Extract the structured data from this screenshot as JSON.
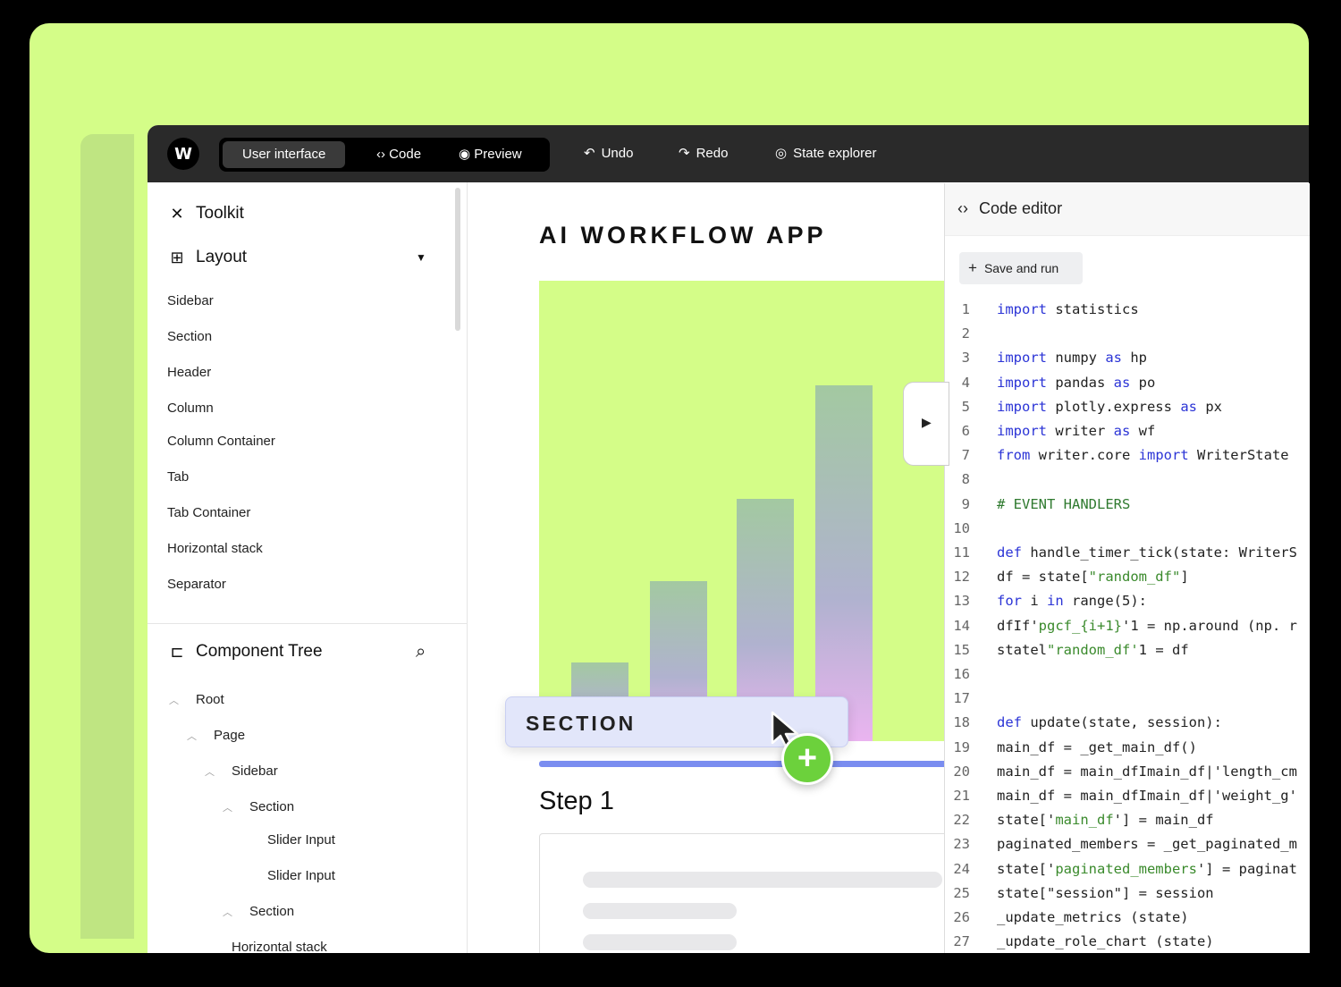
{
  "topbar": {
    "logo": "W",
    "modes": [
      {
        "label": "User interface",
        "active": true
      },
      {
        "label": "Code",
        "icon": "<>"
      },
      {
        "label": "Preview",
        "icon": "eye-icon"
      }
    ],
    "undo": "Undo",
    "redo": "Redo",
    "state_explorer": "State explorer"
  },
  "sidebar": {
    "toolkit": "Toolkit",
    "layout": "Layout",
    "layout_items": [
      "Sidebar",
      "Section",
      "Header",
      "Column",
      "Column Container",
      "Tab",
      "Tab Container",
      "Horizontal stack",
      "Separator"
    ],
    "component_tree": "Component Tree",
    "tree": [
      {
        "label": "Root",
        "depth": 0,
        "chevron": true
      },
      {
        "label": "Page",
        "depth": 1,
        "chevron": true
      },
      {
        "label": "Sidebar",
        "depth": 2,
        "chevron": true
      },
      {
        "label": "Section",
        "depth": 3,
        "chevron": true
      },
      {
        "label": "Slider Input",
        "depth": 4,
        "chevron": false
      },
      {
        "label": "Slider Input",
        "depth": 4,
        "chevron": false
      },
      {
        "label": "Section",
        "depth": 3,
        "chevron": true
      },
      {
        "label": "Horizontal stack",
        "depth": 2,
        "chevron": false
      }
    ]
  },
  "canvas": {
    "title": "AI WORKFLOW APP",
    "chart_bars": [
      0.22,
      0.45,
      0.68,
      1.0
    ],
    "step_title": "Step 1",
    "section_chip": "SECTION"
  },
  "editor": {
    "title": "Code editor",
    "save_label": "Save and run",
    "lines": [
      [
        [
          "kw",
          "import"
        ],
        [
          "",
          "statistics"
        ]
      ],
      [],
      [
        [
          "kw",
          "import"
        ],
        [
          "",
          "numpy "
        ],
        [
          "kw",
          "as"
        ],
        [
          "",
          "hp"
        ]
      ],
      [
        [
          "kw",
          "import"
        ],
        [
          "",
          "pandas "
        ],
        [
          "kw",
          "as"
        ],
        [
          "",
          "po"
        ]
      ],
      [
        [
          "kw",
          "import"
        ],
        [
          "",
          "plotly.express "
        ],
        [
          "kw",
          "as"
        ],
        [
          "",
          "px"
        ]
      ],
      [
        [
          "kw",
          "import"
        ],
        [
          "",
          "writer "
        ],
        [
          "kw",
          "as"
        ],
        [
          "",
          "wf"
        ]
      ],
      [
        [
          "kw",
          "from"
        ],
        [
          "",
          "writer.core "
        ],
        [
          "kw",
          "import"
        ],
        [
          "",
          "WriterState"
        ]
      ],
      [],
      [
        [
          "cm",
          "# EVENT HANDLERS"
        ]
      ],
      [],
      [
        [
          "kw",
          "def"
        ],
        [
          "",
          "handle_timer_tick(state: WriterS"
        ]
      ],
      [
        [
          "",
          "df = state["
        ],
        [
          "str",
          "\"random_df\""
        ],
        [
          "",
          "]"
        ]
      ],
      [
        [
          "kw",
          "for"
        ],
        [
          "",
          "i "
        ],
        [
          "kw",
          "in"
        ],
        [
          "",
          "range(5):"
        ]
      ],
      [
        [
          "",
          "dfIf'"
        ],
        [
          "str",
          "pgcf_{i+1}"
        ],
        [
          "",
          "'1 = np.around (np. r"
        ]
      ],
      [
        [
          "",
          "statel"
        ],
        [
          "str",
          "\"random_df'"
        ],
        [
          "",
          "1 = df"
        ]
      ],
      [],
      [],
      [
        [
          "kw",
          "def"
        ],
        [
          "",
          "update(state, session):"
        ]
      ],
      [
        [
          "",
          "main_df = _get_main_df()"
        ]
      ],
      [
        [
          "",
          "main_df = main_dfImain_df|'length_cm"
        ]
      ],
      [
        [
          "",
          "main_df = main_dfImain_df|'weight_g'"
        ]
      ],
      [
        [
          "",
          "state['"
        ],
        [
          "str",
          "main_df"
        ],
        [
          "",
          "'] = main_df"
        ]
      ],
      [
        [
          "",
          "paginated_members = _get_paginated_m"
        ]
      ],
      [
        [
          "",
          "state['"
        ],
        [
          "str",
          "paginated_members"
        ],
        [
          "",
          "'] = paginat"
        ]
      ],
      [
        [
          "",
          "state[\"session\"] = session"
        ]
      ],
      [
        [
          "",
          "_update_metrics (state)"
        ]
      ],
      [
        [
          "",
          "_update_role_chart (state)"
        ]
      ]
    ]
  }
}
